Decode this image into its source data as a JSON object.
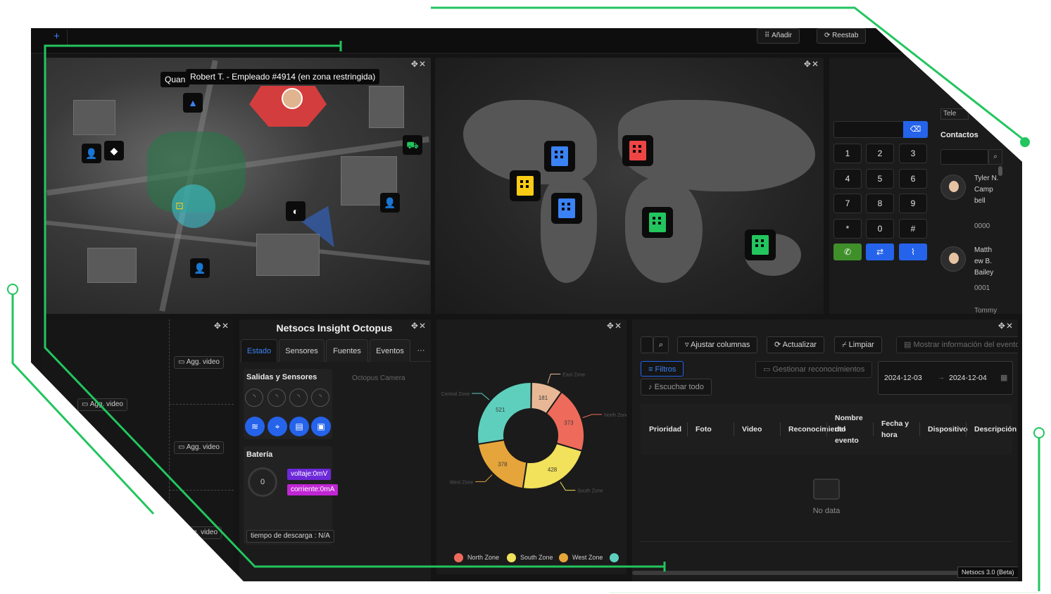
{
  "toolbar": {
    "add_label": "Añadir",
    "reset_label": "Reestab"
  },
  "city_map": {
    "tooltip_text": "Robert T. - Empleado #4914 (en zona restringida)",
    "hidden_label": "Quan"
  },
  "dialer": {
    "keys": [
      "1",
      "2",
      "3",
      "4",
      "5",
      "6",
      "7",
      "8",
      "9",
      "*",
      "0",
      "#"
    ],
    "tab_label": "Tele",
    "contacts_title": "Contactos",
    "contacts": [
      {
        "name": "Tyler N. Camp bell",
        "number": "0000"
      },
      {
        "name": "Matth ew B. Bailey",
        "number": "0001"
      },
      {
        "name": "Tommy",
        "number": ""
      }
    ]
  },
  "video_grid": {
    "add_video_label": "Agg. video",
    "partial_label": "g. video"
  },
  "octopus": {
    "title": "Netsocs Insight Octopus",
    "tabs": [
      "Estado",
      "Sensores",
      "Fuentes",
      "Eventos"
    ],
    "more_label": "···",
    "outputs_title": "Salidas y Sensores",
    "battery_title": "Batería",
    "gauge_value": "0",
    "voltage": "voltaje:0mV",
    "current": "corriente:0mA",
    "discharge": "tiempo de descarga : N/A",
    "camera_alt": "Octopus Camera"
  },
  "chart_data": {
    "type": "pie",
    "subtype": "donut",
    "categories": [
      "East Zone",
      "North Zone",
      "South Zone",
      "West Zone",
      "Central Zone"
    ],
    "values": [
      181,
      373,
      428,
      378,
      521
    ],
    "colors": [
      "#e8b896",
      "#ee6b5b",
      "#f2e15a",
      "#e6a53a",
      "#5ecfbd"
    ],
    "legend": [
      "North Zone",
      "South Zone",
      "West Zone"
    ],
    "legend_placement": "bottom"
  },
  "events": {
    "ajustar_label": "Ajustar columnas",
    "actualizar_label": "Actualizar",
    "limpiar_label": "Limpiar",
    "mostrar_label": "Mostrar información del evento",
    "filtros_label": "Filtros",
    "gestionar_label": "Gestionar reconocimientos",
    "escuchar_label": "Escuchar todo",
    "date_from": "2024-12-03",
    "date_to": "2024-12-04",
    "date_arrow": "→",
    "columns": [
      "Prioridad",
      "Foto",
      "Video",
      "Reconocimiento",
      "Nombre del evento",
      "Fecha y hora",
      "Dispositivo",
      "Descripción"
    ],
    "no_data": "No data",
    "version": "Netsocs 3.0 (Beta)"
  },
  "colors": {
    "accent_green": "#22c55e",
    "accent_blue": "#2563eb",
    "dial_call": "#3f8f2a",
    "panel_bg": "#1b1b1b"
  }
}
